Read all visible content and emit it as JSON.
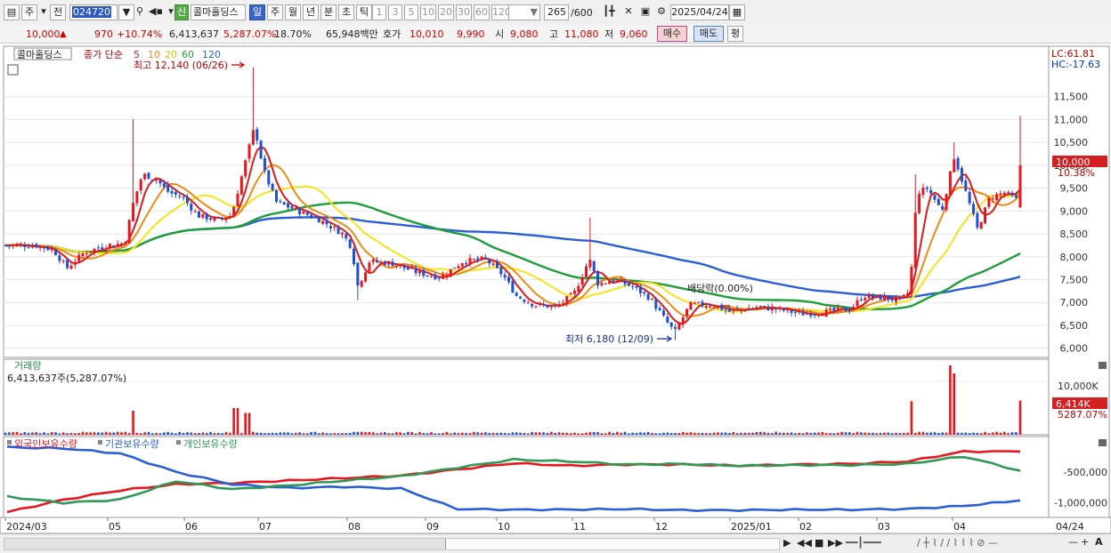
{
  "toolbar": {
    "stock_code": "024720",
    "stock_name": "콜마홀딩스",
    "new_badge": "신",
    "market_type": "주",
    "prev_label": "전",
    "period_tabs": [
      "일",
      "주",
      "월",
      "년",
      "분",
      "초",
      "틱"
    ],
    "active_period": "일",
    "interval_buttons": [
      "1",
      "3",
      "5",
      "10",
      "20",
      "30",
      "60",
      "120"
    ],
    "count_display": "265",
    "count_total": "/600",
    "date": "2025/04/24"
  },
  "quote": {
    "price": "10,000",
    "arrow": "▲",
    "change": "970",
    "change_pct": "+10.74%",
    "volume": "6,413,637",
    "volume_ratio": "5,287.07%",
    "turnover": "18.70%",
    "amount": "65,948백만",
    "bid_label": "호가",
    "bid1": "10,010",
    "bid2": "9,990",
    "open_label": "시",
    "open": "9,080",
    "high_label": "고",
    "high": "11,080",
    "low_label": "저",
    "low": "9,060",
    "buy_button": "매수",
    "sell_button": "매도",
    "eval_button": "평"
  },
  "price_panel": {
    "legend_name": "콜마홀딩스",
    "legend_indicator": "종가 단순",
    "ma_periods": [
      "5",
      "10",
      "20",
      "60",
      "120"
    ],
    "max_label": "최고 12,140 (06/26)",
    "min_label": "최저 6,180 (12/09)",
    "ex_dividend_label": "배당락(0.00%)",
    "lc_label": "LC:61.81",
    "hc_label": "HC:-17.63",
    "current_price_tag": "10,000",
    "current_pct_tag": "10.38%"
  },
  "volume_panel": {
    "title": "거래량",
    "value_text": "6,413,637주(5,287.07%)",
    "axis_label": "10,000K",
    "current_tag": "6,414K",
    "current_pct": "5287.07%"
  },
  "holding_panel": {
    "legend": [
      "외국인보유수량",
      "기관보유수량",
      "개인보유수량"
    ],
    "axis_labels": [
      "-500,000",
      "-1,000,000"
    ]
  },
  "x_axis_labels": [
    "2024/03",
    "05",
    "06",
    "07",
    "08",
    "09",
    "10",
    "11",
    "12",
    "2025/01",
    "02",
    "03",
    "04"
  ],
  "last_x_label": "04/24",
  "colors": {
    "up": "#e8161e",
    "down": "#1f4fd6",
    "ma5": "#e01818",
    "ma10": "#f08a14",
    "ma20": "#f5e41a",
    "ma60": "#1e9e3a",
    "ma120": "#2a5ed8",
    "foreign": "#e8161e",
    "institution": "#2a5ed8",
    "individual": "#2e9a55"
  },
  "chart_data": [
    {
      "type": "candlestick",
      "title": "콜마홀딩스",
      "ylim": [
        5800,
        12600
      ],
      "y_ticks": [
        6000,
        6500,
        7000,
        7500,
        8000,
        8500,
        9000,
        9500,
        10000,
        10500,
        11000,
        11500
      ],
      "x_ticks": [
        "2024/03",
        "05",
        "06",
        "07",
        "08",
        "09",
        "10",
        "11",
        "12",
        "2025/01",
        "02",
        "03",
        "04"
      ],
      "close_approx": [
        {
          "date": "2024/03",
          "close": 8250
        },
        {
          "date": "2024/04 start",
          "close": 8200
        },
        {
          "date": "2024/04 dip",
          "close": 7700
        },
        {
          "date": "2024/04 end",
          "close": 8200
        },
        {
          "date": "2024/05 spike",
          "close": 9800
        },
        {
          "date": "2024/05 mid",
          "close": 9600
        },
        {
          "date": "2024/06 start",
          "close": 9200
        },
        {
          "date": "2024/06 mid",
          "close": 8800
        },
        {
          "date": "2024/06/26",
          "close": 10800
        },
        {
          "date": "2024/07 start",
          "close": 9400
        },
        {
          "date": "2024/07 mid",
          "close": 9000
        },
        {
          "date": "2024/07 end",
          "close": 8700
        },
        {
          "date": "2024/08 start",
          "close": 8300
        },
        {
          "date": "2024/08 crash",
          "close": 7300
        },
        {
          "date": "2024/08 mid",
          "close": 7900
        },
        {
          "date": "2024/09",
          "close": 7600
        },
        {
          "date": "2024/09 end",
          "close": 7900
        },
        {
          "date": "2024/10 mid",
          "close": 7100
        },
        {
          "date": "2024/10 end",
          "close": 6900
        },
        {
          "date": "2024/11 spike",
          "close": 8000
        },
        {
          "date": "2024/11 mid",
          "close": 7500
        },
        {
          "date": "2024/12/09",
          "close": 6400
        },
        {
          "date": "2024/12 end",
          "close": 6900
        },
        {
          "date": "2025/01",
          "close": 6900
        },
        {
          "date": "2025/02",
          "close": 6800
        },
        {
          "date": "2025/03 start",
          "close": 7000
        },
        {
          "date": "2025/03 mid",
          "close": 7200
        },
        {
          "date": "2025/03 spike",
          "close": 9400
        },
        {
          "date": "2025/04 start",
          "close": 10300
        },
        {
          "date": "2025/04 mid",
          "close": 8800
        },
        {
          "date": "2025/04/24",
          "close": 10000
        }
      ],
      "max": {
        "date": "06/26",
        "value": 12140
      },
      "min": {
        "date": "12/09",
        "value": 6180
      },
      "last": {
        "open": 9080,
        "high": 11080,
        "low": 9060,
        "close": 10000
      }
    },
    {
      "type": "bar",
      "title": "거래량",
      "ylabel": "",
      "series": [
        {
          "name": "거래량",
          "last_value": 6413637
        }
      ],
      "peaks_k": [
        {
          "date": "2024/05",
          "value": 4500
        },
        {
          "date": "2024/06/26",
          "value": 5000
        },
        {
          "date": "2025/03",
          "value": 6300
        },
        {
          "date": "2025/04 start",
          "value": 13000
        },
        {
          "date": "2025/04/24",
          "value": 6414
        }
      ]
    },
    {
      "type": "line",
      "series": [
        {
          "name": "외국인보유수량",
          "trend": [
            -1150000,
            -950000,
            -800000,
            -700000,
            -680000,
            -640000,
            -600000,
            -560000,
            -460000,
            -360000,
            -400000,
            -380000,
            -380000,
            -400000,
            -380000,
            -370000,
            -330000,
            -170000,
            -170000
          ]
        },
        {
          "name": "기관보유수량",
          "trend": [
            -100000,
            -120000,
            -200000,
            -500000,
            -700000,
            -760000,
            -740000,
            -770000,
            -1100000,
            -1110000,
            -1110000,
            -1100000,
            -1120000,
            -1120000,
            -1110000,
            -1110000,
            -1100000,
            -1050000,
            -960000
          ]
        },
        {
          "name": "개인보유수량",
          "trend": [
            -900000,
            -1000000,
            -950000,
            -650000,
            -780000,
            -720000,
            -640000,
            -570000,
            -430000,
            -300000,
            -330000,
            -380000,
            -370000,
            -400000,
            -390000,
            -390000,
            -370000,
            -250000,
            -480000
          ]
        }
      ],
      "y_ticks": [
        -500000,
        -1000000
      ]
    }
  ]
}
